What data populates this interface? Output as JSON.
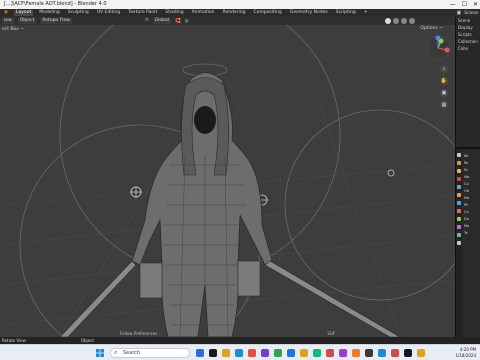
{
  "window": {
    "title": "[...]\\ACF\\Female AOT.blend] - Blender 4.0",
    "minimize": "—",
    "maximize": "☐",
    "close": "✕"
  },
  "menubar": {
    "workspaces": [
      "Layout",
      "Modeling",
      "Sculpting",
      "UV Editing",
      "Texture Paint",
      "Shading",
      "Animation",
      "Rendering",
      "Compositing",
      "Geometry Nodes",
      "Scripting",
      "+"
    ],
    "active_index": 0,
    "scene_label": "Scene"
  },
  "toolbar": {
    "view_label": "iew",
    "object_label": "Object",
    "snap_label": "Retopo Flow",
    "global_label": "Global",
    "add_label": "Add"
  },
  "viewport": {
    "header_left": "ect Box ~",
    "options_label": "Options ~",
    "footer": [
      "Follow Preferences",
      "SUF"
    ],
    "gizmo_axes": {
      "x": "#e05757",
      "y": "#8bd44a",
      "z": "#4f86e8"
    }
  },
  "outliner": {
    "rows": [
      "Scene",
      "Display",
      "Scripts",
      "Collection",
      "Colle"
    ]
  },
  "properties": {
    "rows": [
      "Ite",
      "Re",
      "Sc",
      "Wo",
      "Co",
      "Ob",
      "Mo",
      "Ph",
      "Co",
      "Da",
      "Ma",
      "Te"
    ],
    "tab_colors": [
      "#c9c9c9",
      "#d49a45",
      "#e0b85a",
      "#d44a4a",
      "#6aa0e0",
      "#ef9b3f",
      "#4fa6d8",
      "#e86b6b",
      "#8bd44a",
      "#c86be0",
      "#5ac4a8",
      "#c9c9c9"
    ]
  },
  "statusbar": {
    "left": "Rotate View",
    "mid": "Object"
  },
  "taskbar": {
    "search_placeholder": "Search",
    "app_colors": [
      "#2d6ae0",
      "#1a1a1a",
      "#e0a020",
      "#1f8ad8",
      "#e84f3a",
      "#7a3ad8",
      "#2da44e",
      "#1a73e8",
      "#e0a020",
      "#10b981",
      "#d44a4a",
      "#9f3ad8",
      "#f07b24",
      "#3a3a3a",
      "#1f8ad8",
      "#d44a4a",
      "#0f172a",
      "#e0a020"
    ],
    "time": "4:20 PM",
    "date": "1/18/2024"
  }
}
